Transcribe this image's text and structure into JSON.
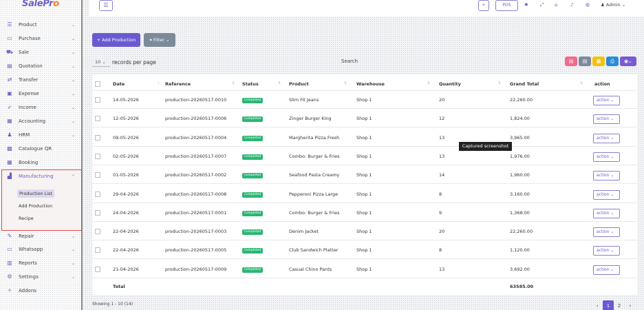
{
  "sidebar": {
    "logo": "SalePro",
    "items": [
      {
        "label": "Product",
        "icon": "list-icon"
      },
      {
        "label": "Purchase",
        "icon": "card-icon"
      },
      {
        "label": "Sale",
        "icon": "cart-icon"
      },
      {
        "label": "Quotation",
        "icon": "document-icon"
      },
      {
        "label": "Transfer",
        "icon": "transfer-icon"
      },
      {
        "label": "Expense",
        "icon": "wallet-icon"
      },
      {
        "label": "Income",
        "icon": "rocket-icon"
      },
      {
        "label": "Accounting",
        "icon": "briefcase-icon"
      },
      {
        "label": "HRM",
        "icon": "users-icon"
      },
      {
        "label": "Catalogue QR",
        "icon": "qr-icon"
      },
      {
        "label": "Booking",
        "icon": "calendar-icon"
      },
      {
        "label": "Manufacturing",
        "icon": "factory-icon"
      },
      {
        "label": "Repair",
        "icon": "wrench-icon"
      },
      {
        "label": "Whatsapp",
        "icon": "monitor-icon"
      },
      {
        "label": "Reports",
        "icon": "report-icon"
      },
      {
        "label": "Settings",
        "icon": "gear-icon"
      },
      {
        "label": "Addons",
        "icon": "puzzle-icon"
      }
    ],
    "manufacturing_sub": [
      "Production List",
      "Add Production",
      "Recipe"
    ]
  },
  "topbar": {
    "menu_icon": "hamburger-icon",
    "pos_label": "POS",
    "admin_label": "Admin"
  },
  "toolbar": {
    "add_label": "+ Add Production",
    "filter_label": "Filter",
    "per_page_value": "10",
    "per_page_label": "records per page",
    "search_label": "Search"
  },
  "table": {
    "columns": [
      "Date",
      "Reference",
      "Status",
      "Product",
      "Warehouse",
      "Quantity",
      "Grand Total",
      "action"
    ],
    "rows": [
      {
        "date": "14-05-2026",
        "ref": "production-20260517-0010",
        "status": "Completed",
        "product": "Slim Fit Jeans",
        "warehouse": "Shop 1",
        "qty": "20",
        "total": "22,260.00"
      },
      {
        "date": "12-05-2026",
        "ref": "production-20260517-0006",
        "status": "Completed",
        "product": "Zinger Burger King",
        "warehouse": "Shop 1",
        "qty": "12",
        "total": "1,824.00"
      },
      {
        "date": "09-05-2026",
        "ref": "production-20260517-0004",
        "status": "Completed",
        "product": "Margherita Pizza Fresh",
        "warehouse": "Shop 1",
        "qty": "13",
        "total": "3,965.00"
      },
      {
        "date": "02-05-2026",
        "ref": "production-20260517-0007",
        "status": "Completed",
        "product": "Combo: Burger & Fries",
        "warehouse": "Shop 1",
        "qty": "13",
        "total": "1,976.00"
      },
      {
        "date": "01-05-2026",
        "ref": "production-20260517-0002",
        "status": "Completed",
        "product": "Seafood Pasta Creamy",
        "warehouse": "Shop 1",
        "qty": "14",
        "total": "1,960.00"
      },
      {
        "date": "29-04-2026",
        "ref": "production-20260517-0008",
        "status": "Completed",
        "product": "Pepperoni Pizza Large",
        "warehouse": "Shop 1",
        "qty": "8",
        "total": "3,160.00"
      },
      {
        "date": "24-04-2026",
        "ref": "production-20260517-0001",
        "status": "Completed",
        "product": "Combo: Burger & Fries",
        "warehouse": "Shop 1",
        "qty": "9",
        "total": "1,368.00"
      },
      {
        "date": "22-04-2026",
        "ref": "production-20260517-0003",
        "status": "Completed",
        "product": "Denim Jacket",
        "warehouse": "Shop 1",
        "qty": "20",
        "total": "22,260.00"
      },
      {
        "date": "22-04-2026",
        "ref": "production-20260517-0005",
        "status": "Completed",
        "product": "Club Sandwich Platter",
        "warehouse": "Shop 1",
        "qty": "8",
        "total": "1,120.00"
      },
      {
        "date": "21-04-2026",
        "ref": "production-20260517-0009",
        "status": "Completed",
        "product": "Casual Chino Pants",
        "warehouse": "Shop 1",
        "qty": "13",
        "total": "3,692.00"
      }
    ],
    "action_label": "action",
    "total_label": "Total",
    "grand_total": "63585.00"
  },
  "tooltip": "Captured screenshot",
  "footer": {
    "showing": "Showing 1 - 10 (14)",
    "pages": [
      "1",
      "2"
    ]
  },
  "colors": {
    "accent": "#6a5ad1",
    "completed": "#2bb673",
    "highlight_border": "#e04848"
  }
}
